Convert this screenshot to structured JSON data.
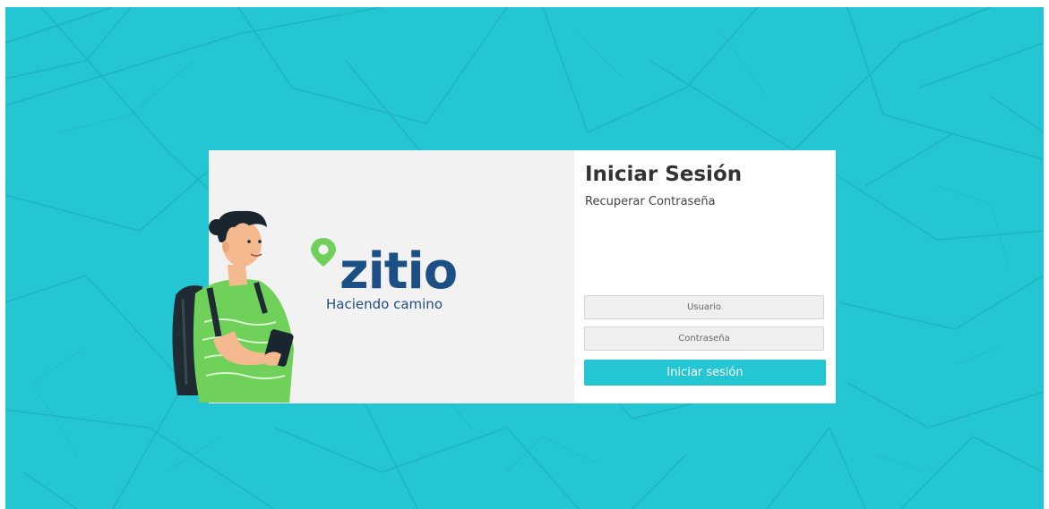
{
  "page": {
    "background_color": "#25c6d3",
    "accent_color": "#25c6d3",
    "brand_color": "#1c4f86"
  },
  "brand": {
    "logo_text": "zitio",
    "tagline": "Haciendo camino",
    "pin_icon": "map-pin-icon"
  },
  "login": {
    "title": "Iniciar Sesión",
    "recover_link": "Recuperar Contraseña",
    "username_placeholder": "Usuario",
    "password_placeholder": "Contraseña",
    "submit_label": "Iniciar sesión"
  },
  "illustration": {
    "icon": "person-with-phone-illustration"
  }
}
